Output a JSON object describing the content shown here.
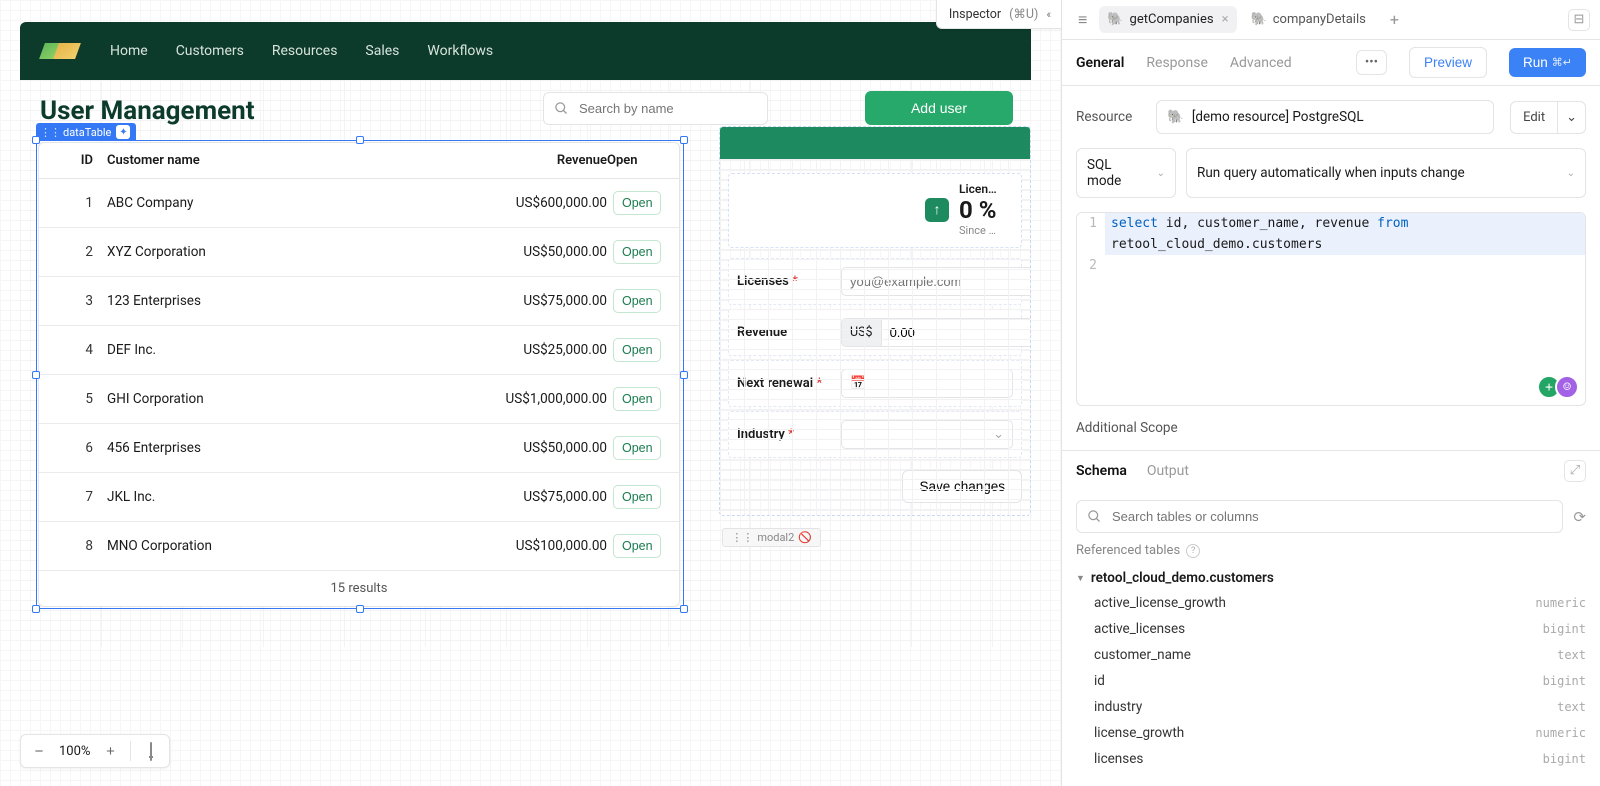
{
  "inspector_badge": {
    "label": "Inspector",
    "shortcut": "(⌘U)"
  },
  "app": {
    "nav": [
      "Home",
      "Customers",
      "Resources",
      "Sales",
      "Workflows"
    ],
    "page_title": "User Management",
    "selected_component": "dataTable",
    "search_placeholder": "Search by name",
    "add_user_label": "Add user",
    "table": {
      "columns": {
        "id": "ID",
        "name": "Customer name",
        "revenue": "Revenue",
        "action": "Open"
      },
      "rows": [
        {
          "id": 1,
          "name": "ABC Company",
          "revenue": "US$600,000.00",
          "action": "Open"
        },
        {
          "id": 2,
          "name": "XYZ Corporation",
          "revenue": "US$50,000.00",
          "action": "Open"
        },
        {
          "id": 3,
          "name": "123 Enterprises",
          "revenue": "US$75,000.00",
          "action": "Open"
        },
        {
          "id": 4,
          "name": "DEF Inc.",
          "revenue": "US$25,000.00",
          "action": "Open"
        },
        {
          "id": 5,
          "name": "GHI Corporation",
          "revenue": "US$1,000,000.00",
          "action": "Open"
        },
        {
          "id": 6,
          "name": "456 Enterprises",
          "revenue": "US$50,000.00",
          "action": "Open"
        },
        {
          "id": 7,
          "name": "JKL Inc.",
          "revenue": "US$75,000.00",
          "action": "Open"
        },
        {
          "id": 8,
          "name": "MNO Corporation",
          "revenue": "US$100,000.00",
          "action": "Open"
        }
      ],
      "footer": "15 results"
    },
    "detail": {
      "kpi": {
        "label": "Licen…",
        "value": "0 %",
        "sub": "Since …"
      },
      "licenses": {
        "label": "Licenses",
        "placeholder": "you@example.com"
      },
      "revenue": {
        "label": "Revenue",
        "prefix": "US$",
        "value": "0.00"
      },
      "renewal": {
        "label": "Next renewal"
      },
      "industry": {
        "label": "Industry"
      },
      "save": "Save changes"
    },
    "modal_chip": "modal2",
    "zoom": "100%"
  },
  "inspector": {
    "tabs": [
      {
        "name": "getCompanies",
        "active": true
      },
      {
        "name": "companyDetails",
        "active": false
      }
    ],
    "subtabs": {
      "general": "General",
      "response": "Response",
      "advanced": "Advanced"
    },
    "preview": "Preview",
    "run": "Run",
    "run_kbd": "⌘↵",
    "resource": {
      "label": "Resource",
      "value": "[demo resource] PostgreSQL",
      "edit": "Edit"
    },
    "mode": {
      "label": "SQL mode",
      "trigger": "Run query automatically when inputs change"
    },
    "sql": {
      "line1_parts": {
        "select": "select",
        "cols": " id, customer_name, revenue ",
        "from": "from"
      },
      "line1_cont": "retool_cloud_demo.customers"
    },
    "additional_scope": "Additional Scope",
    "schema": {
      "tabs": {
        "schema": "Schema",
        "output": "Output"
      },
      "search_placeholder": "Search tables or columns",
      "section_label": "Referenced tables",
      "table_name": "retool_cloud_demo.customers",
      "columns": [
        {
          "name": "active_license_growth",
          "type": "numeric"
        },
        {
          "name": "active_licenses",
          "type": "bigint"
        },
        {
          "name": "customer_name",
          "type": "text"
        },
        {
          "name": "id",
          "type": "bigint"
        },
        {
          "name": "industry",
          "type": "text"
        },
        {
          "name": "license_growth",
          "type": "numeric"
        },
        {
          "name": "licenses",
          "type": "bigint"
        }
      ]
    }
  }
}
